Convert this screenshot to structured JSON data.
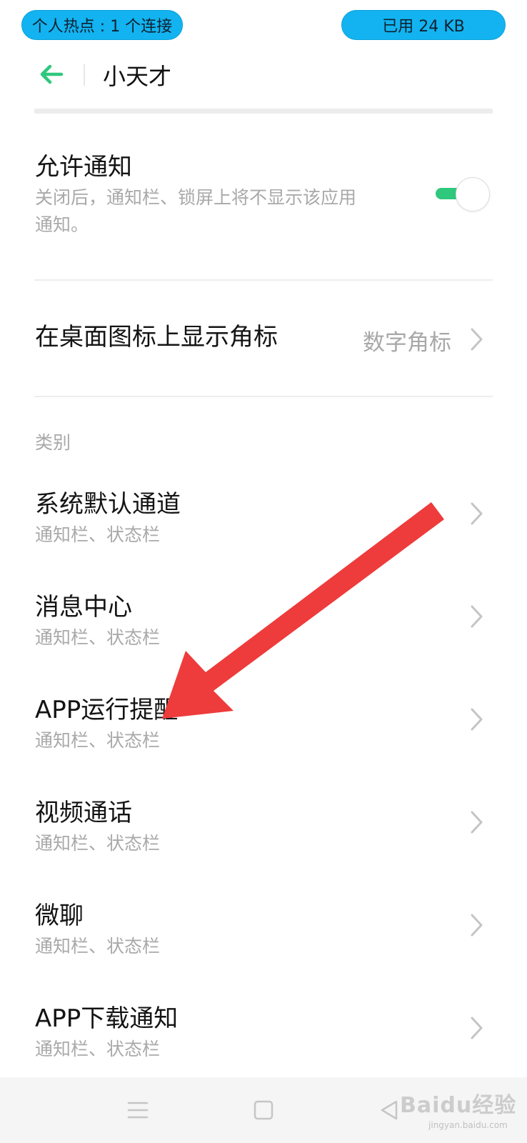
{
  "status": {
    "hotspot": "个人热点 : 1 个连接",
    "data_used": "已用 24 KB"
  },
  "header": {
    "title": "小天才"
  },
  "allow_notifications": {
    "title": "允许通知",
    "description_line1": "关闭后，通知栏、锁屏上将不显示该应用",
    "description_line2": "通知。",
    "enabled": true
  },
  "badge": {
    "title": "在桌面图标上显示角标",
    "value": "数字角标"
  },
  "section_label": "类别",
  "channels": [
    {
      "title": "系统默认通道",
      "subtitle": "通知栏、状态栏"
    },
    {
      "title": "消息中心",
      "subtitle": "通知栏、状态栏"
    },
    {
      "title": "APP运行提醒",
      "subtitle": "通知栏、状态栏"
    },
    {
      "title": "视频通话",
      "subtitle": "通知栏、状态栏"
    },
    {
      "title": "微聊",
      "subtitle": "通知栏、状态栏"
    },
    {
      "title": "APP下载通知",
      "subtitle": "通知栏、状态栏"
    }
  ],
  "watermark": {
    "brand": "Baidu经验",
    "url": "jingyan.baidu.com"
  },
  "colors": {
    "accent_green": "#2fc87d",
    "pill_blue": "#12b3f0",
    "arrow_red": "#ee3b3b"
  }
}
